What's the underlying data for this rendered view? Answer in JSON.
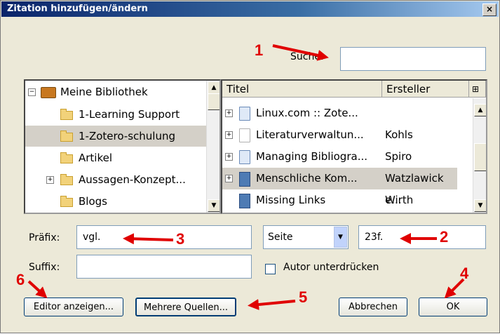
{
  "dialog": {
    "title": "Zitation hinzufügen/ändern",
    "close_label": "×"
  },
  "search": {
    "label": "Suche:",
    "value": ""
  },
  "library_tree": {
    "items": [
      {
        "label": "Meine Bibliothek",
        "icon": "library-icon",
        "expander": "⊟"
      },
      {
        "label": "1-Learning Support",
        "icon": "folder-icon"
      },
      {
        "label": "1-Zotero-schulung",
        "icon": "folder-icon",
        "selected": true
      },
      {
        "label": "Artikel",
        "icon": "folder-icon"
      },
      {
        "label": "Aussagen-Konzept...",
        "icon": "folder-icon",
        "expander": "⊞"
      },
      {
        "label": "Blogs",
        "icon": "folder-icon"
      }
    ]
  },
  "items_list": {
    "columns": [
      "Titel",
      "Ersteller"
    ],
    "column_picker_icon": "column-picker-icon",
    "rows": [
      {
        "title": "Linux.com :: Zote...",
        "creator": "",
        "icon": "webpage-icon"
      },
      {
        "title": "Literaturverwaltun...",
        "creator": "Kohls",
        "icon": "document-icon"
      },
      {
        "title": "Managing Bibliogra...",
        "creator": "Spiro",
        "icon": "webpage-icon"
      },
      {
        "title": "Menschliche Kom...",
        "creator": "Watzlawick e...",
        "icon": "book-icon",
        "selected": true
      },
      {
        "title": "Missing Links",
        "creator": "Wirth",
        "icon": "book-icon"
      }
    ]
  },
  "prefix": {
    "label": "Präfix:",
    "value": "vgl."
  },
  "suffix": {
    "label": "Suffix:",
    "value": ""
  },
  "locator": {
    "type": "Seite",
    "value": "23f."
  },
  "suppress_author": {
    "label": "Autor unterdrücken",
    "checked": false
  },
  "buttons": {
    "editor": "Editor anzeigen...",
    "multiple": "Mehrere Quellen...",
    "cancel": "Abbrechen",
    "ok": "OK"
  },
  "annotations": [
    "1",
    "2",
    "3",
    "4",
    "5",
    "6"
  ],
  "colors": {
    "annotation": "#e00000",
    "titlebar": "#0a246a",
    "dialog_bg": "#ece9d8"
  }
}
